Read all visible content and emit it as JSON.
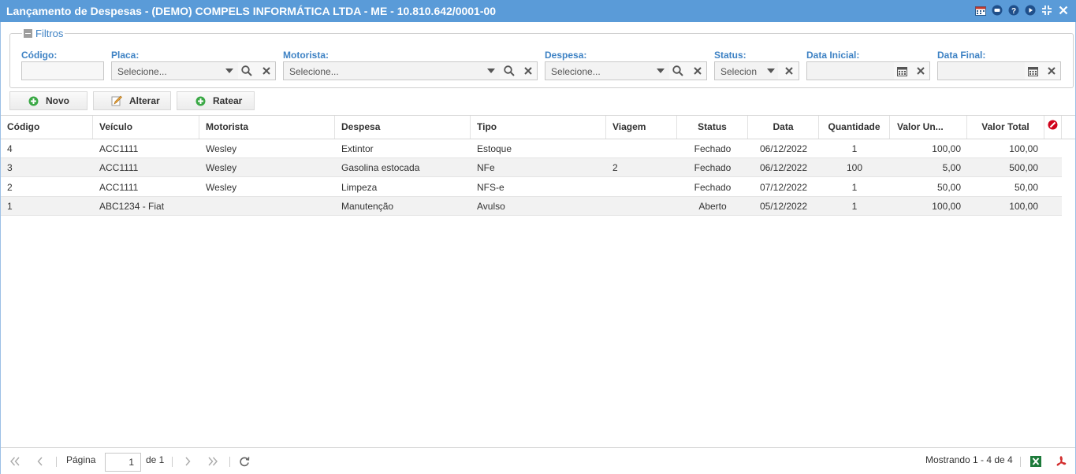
{
  "window": {
    "title": "Lançamento de Despesas - (DEMO) COMPELS INFORMÁTICA LTDA - ME - 10.810.642/0001-00",
    "icons": [
      "calendar-icon",
      "chat-icon",
      "help-icon",
      "play-icon",
      "collapse-icon",
      "close-icon"
    ]
  },
  "filters": {
    "legend": "Filtros",
    "codigo": {
      "label": "Código:",
      "value": ""
    },
    "placa": {
      "label": "Placa:",
      "placeholder": "Selecione..."
    },
    "motorista": {
      "label": "Motorista:",
      "placeholder": "Selecione..."
    },
    "despesa": {
      "label": "Despesa:",
      "placeholder": "Selecione..."
    },
    "status": {
      "label": "Status:",
      "placeholder": "Selecion"
    },
    "data_inicial": {
      "label": "Data Inicial:",
      "value": ""
    },
    "data_final": {
      "label": "Data Final:",
      "value": ""
    }
  },
  "toolbar": {
    "novo": "Novo",
    "alterar": "Alterar",
    "ratear": "Ratear"
  },
  "grid": {
    "columns": [
      "Código",
      "Veículo",
      "Motorista",
      "Despesa",
      "Tipo",
      "Viagem",
      "Status",
      "Data",
      "Quantidade",
      "Valor Un...",
      "Valor Total"
    ],
    "rows": [
      [
        "4",
        "ACC1111",
        "Wesley",
        "Extintor",
        "Estoque",
        "",
        "Fechado",
        "06/12/2022",
        "1",
        "100,00",
        "100,00"
      ],
      [
        "3",
        "ACC1111",
        "Wesley",
        "Gasolina estocada",
        "NFe",
        "2",
        "Fechado",
        "06/12/2022",
        "100",
        "5,00",
        "500,00"
      ],
      [
        "2",
        "ACC1111",
        "Wesley",
        "Limpeza",
        "NFS-e",
        "",
        "Fechado",
        "07/12/2022",
        "1",
        "50,00",
        "50,00"
      ],
      [
        "1",
        "ABC1234 - Fiat",
        "",
        "Manutenção",
        "Avulso",
        "",
        "Aberto",
        "05/12/2022",
        "1",
        "100,00",
        "100,00"
      ]
    ]
  },
  "pager": {
    "page_label": "Página",
    "page": "1",
    "of_label": "de 1",
    "showing": "Mostrando 1 - 4 de 4"
  },
  "colors": {
    "titlebar": "#5a9bd8",
    "label_blue": "#3e82c4",
    "row_alt": "#f2f2f2"
  }
}
